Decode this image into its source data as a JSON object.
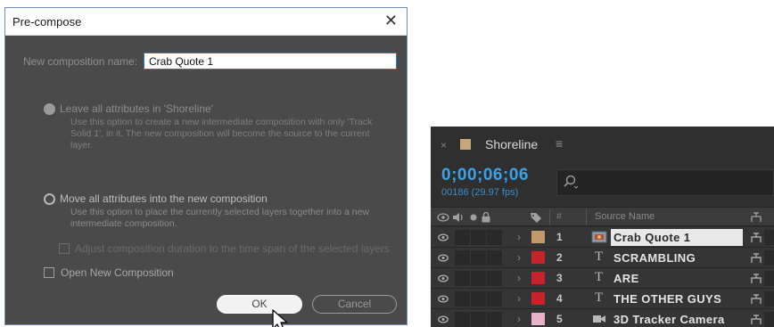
{
  "dialog": {
    "title": "Pre-compose",
    "close_glyph": "✕",
    "name_label": "New composition name:",
    "name_value": "Crab Quote 1",
    "option1_label": "Leave all attributes in 'Shoreline'",
    "option1_desc": "Use this option to create a new intermediate composition with only 'Track Solid 1', in it. The new composition will become the source to the current layer.",
    "option1_state": "disabled",
    "option2_label": "Move all attributes into the new composition",
    "option2_desc": "Use this option to place the currently selected layers together into a new intermediate composition.",
    "option2_state": "selected",
    "adjust_label": "Adjust composition duration to the time span of the selected layers",
    "open_new_label": "Open New Composition",
    "ok_label": "OK",
    "cancel_label": "Cancel"
  },
  "timeline": {
    "close_glyph": "×",
    "comp_name": "Shoreline",
    "menu_glyph": "≡",
    "comp_swatch_color": "#c4a87a",
    "timecode": "0;00;06;06",
    "frames": "00186 (29.97 fps)",
    "search_icon": "search-icon",
    "header_hash": "#",
    "header_source_name": "Source Name",
    "layers": [
      {
        "num": "1",
        "name": "Crab Quote 1",
        "type": "precomp",
        "label_color": "#c29a6a",
        "selected": true
      },
      {
        "num": "2",
        "name": "SCRAMBLING",
        "type": "text",
        "label_color": "#c8232c",
        "selected": false
      },
      {
        "num": "3",
        "name": "ARE",
        "type": "text",
        "label_color": "#c8232c",
        "selected": false
      },
      {
        "num": "4",
        "name": "THE OTHER GUYS",
        "type": "text",
        "label_color": "#c8232c",
        "selected": false
      },
      {
        "num": "5",
        "name": "3D Tracker Camera",
        "type": "camera",
        "label_color": "#e6b3c8",
        "selected": false
      }
    ]
  },
  "colors": {
    "dialog_bg": "#4a4a4a",
    "panel_bg": "#2f2f2f",
    "timecode_blue": "#3aa3e8",
    "input_border": "#2a7fd4"
  }
}
